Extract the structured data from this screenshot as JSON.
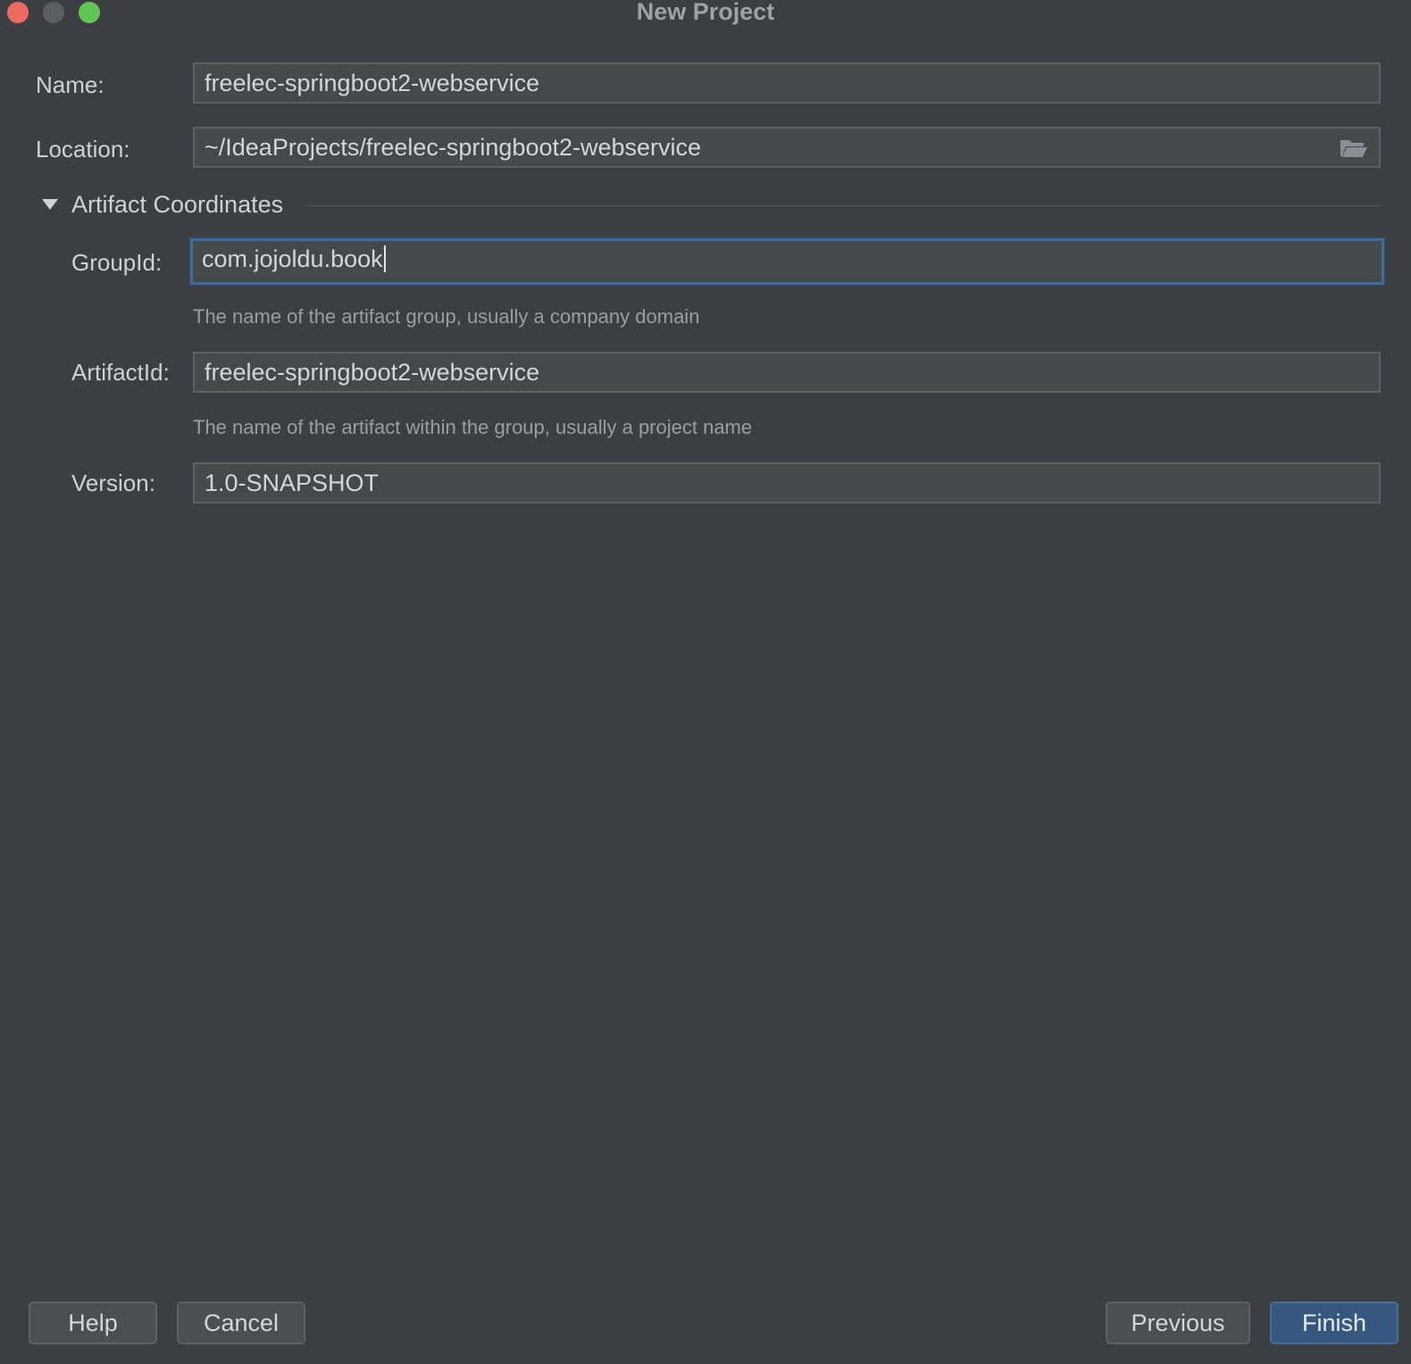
{
  "window": {
    "title": "New Project"
  },
  "form": {
    "name": {
      "label": "Name:",
      "value": "freelec-springboot2-webservice"
    },
    "location": {
      "label": "Location:",
      "value": "~/IdeaProjects/freelec-springboot2-webservice"
    },
    "artifact_section": {
      "title": "Artifact Coordinates",
      "expanded": true,
      "group_id": {
        "label": "GroupId:",
        "value": "com.jojoldu.book",
        "hint": "The name of the artifact group, usually a company domain"
      },
      "artifact_id": {
        "label": "ArtifactId:",
        "value": "freelec-springboot2-webservice",
        "hint": "The name of the artifact within the group, usually a project name"
      },
      "version": {
        "label": "Version:",
        "value": "1.0-SNAPSHOT"
      }
    }
  },
  "buttons": {
    "help": "Help",
    "cancel": "Cancel",
    "previous": "Previous",
    "finish": "Finish"
  },
  "icons": {
    "browse": "folder-open-icon",
    "collapse": "triangle-down-icon"
  },
  "colors": {
    "background": "#3b3f43",
    "field_bg": "#45494a",
    "focus_border": "#3d6b9e",
    "primary_button": "#365880",
    "close": "#ed6a5e",
    "minimize": "#5b5e62",
    "maximize": "#61c554"
  }
}
